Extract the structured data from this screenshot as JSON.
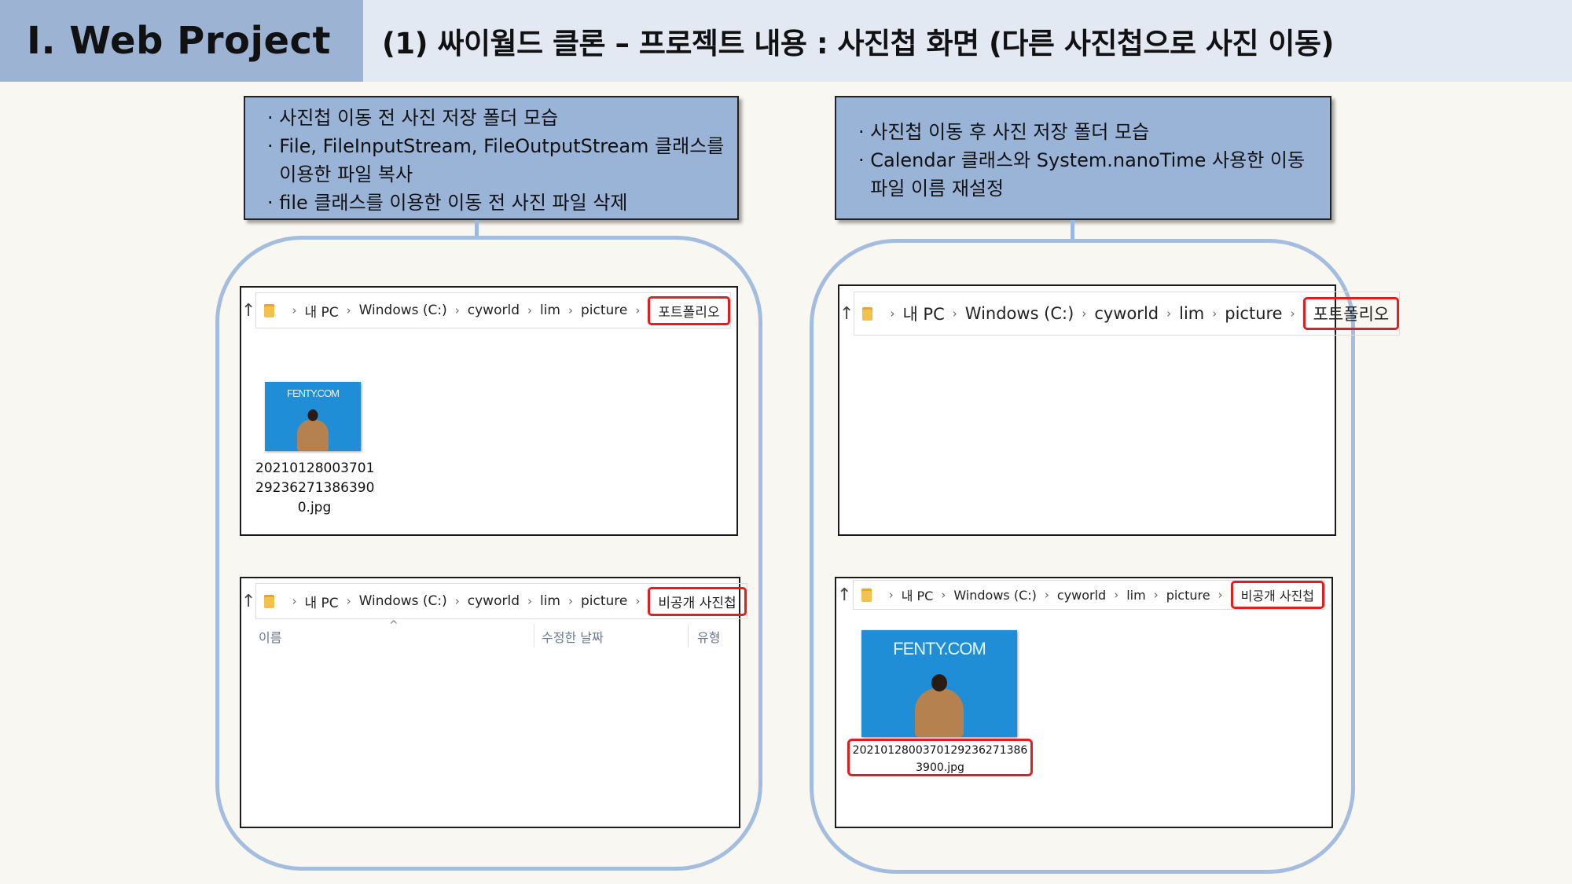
{
  "header": {
    "section_title": "Ⅰ. Web Project",
    "slide_title": "(1) 싸이월드 클론 – 프로젝트 내용 : 사진첩 화면 (다른 사진첩으로 사진 이동)"
  },
  "left_callout": {
    "lines": [
      "· 사진첩 이동 전 사진 저장 폴더 모습",
      "· File, FileInputStream, FileOutputStream 클래스를",
      "  이용한 파일 복사",
      "· file 클래스를 이용한 이동 전 사진 파일 삭제"
    ]
  },
  "right_callout": {
    "lines": [
      "· 사진첩 이동 후 사진 저장 폴더 모습",
      "· Calendar 클래스와 System.nanoTime 사용한 이동",
      "  파일 이름 재설정"
    ]
  },
  "breadcrumb": {
    "pc": "내 PC",
    "drive": "Windows (C:)",
    "dir1": "cyworld",
    "dir2": "lim",
    "dir3": "picture",
    "portfolio": "포트폴리오",
    "private_album": "비공개 사진첩"
  },
  "up_arrow": "↑",
  "chevron": "›",
  "thumbnail_brand": "FENTY.COM",
  "before_portfolio_file": {
    "lines": [
      "20210128003701",
      "29236271386390",
      "0.jpg"
    ]
  },
  "before_private_columns": {
    "name": "이름",
    "date": "수정한 날짜",
    "type": "유형",
    "sort_indicator": "^"
  },
  "after_private_file": {
    "line1": "2021012800370129236271386",
    "line2": "3900.jpg"
  },
  "colors": {
    "header_dark": "#9cb3d4",
    "header_light": "#e3e9f3",
    "callout_fill": "#9ab4d8",
    "frame_border": "#a3bde0",
    "highlight_red": "#e02020",
    "photo_blue": "#1f8ed6"
  },
  "icons": [
    "up-arrow-icon",
    "folder-icon",
    "chevron-right-icon"
  ]
}
